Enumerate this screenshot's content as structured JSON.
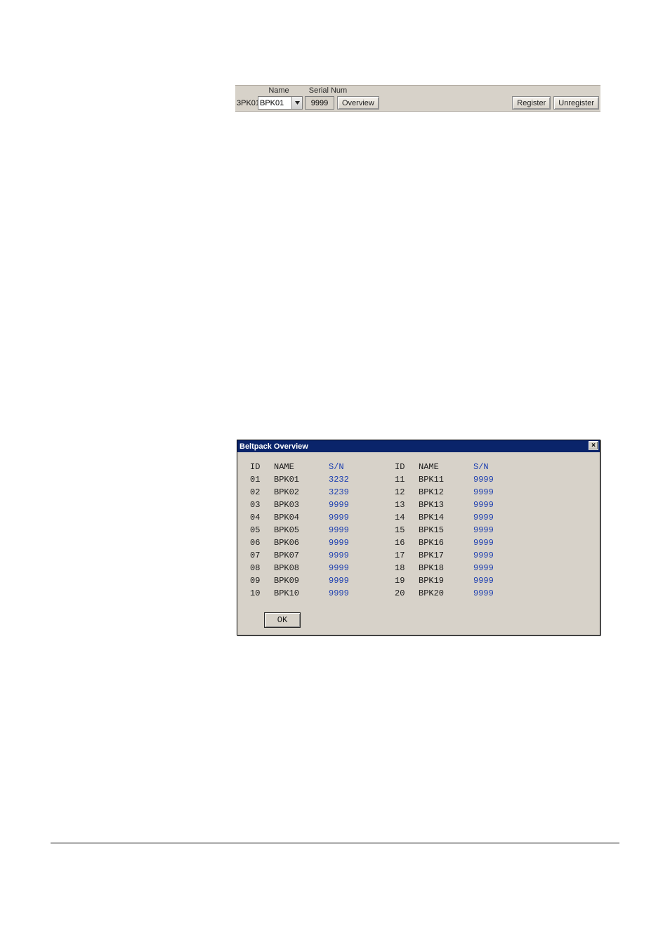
{
  "toolbar": {
    "name_header": "Name",
    "sn_header": "Serial Num",
    "id_value": "3PK01",
    "name_value": "BPK01",
    "sn_value": "9999",
    "overview_label": "Overview",
    "register_label": "Register",
    "unregister_label": "Unregister"
  },
  "dialog": {
    "title": "Beltpack Overview",
    "close_glyph": "×",
    "header_id": "ID",
    "header_name": "NAME",
    "header_sn": "S/N",
    "ok_label": "OK",
    "left_rows": [
      {
        "id": "01",
        "name": "BPK01",
        "sn": "3232"
      },
      {
        "id": "02",
        "name": "BPK02",
        "sn": "3239"
      },
      {
        "id": "03",
        "name": "BPK03",
        "sn": "9999"
      },
      {
        "id": "04",
        "name": "BPK04",
        "sn": "9999"
      },
      {
        "id": "05",
        "name": "BPK05",
        "sn": "9999"
      },
      {
        "id": "06",
        "name": "BPK06",
        "sn": "9999"
      },
      {
        "id": "07",
        "name": "BPK07",
        "sn": "9999"
      },
      {
        "id": "08",
        "name": "BPK08",
        "sn": "9999"
      },
      {
        "id": "09",
        "name": "BPK09",
        "sn": "9999"
      },
      {
        "id": "10",
        "name": "BPK10",
        "sn": "9999"
      }
    ],
    "right_rows": [
      {
        "id": "11",
        "name": "BPK11",
        "sn": "9999"
      },
      {
        "id": "12",
        "name": "BPK12",
        "sn": "9999"
      },
      {
        "id": "13",
        "name": "BPK13",
        "sn": "9999"
      },
      {
        "id": "14",
        "name": "BPK14",
        "sn": "9999"
      },
      {
        "id": "15",
        "name": "BPK15",
        "sn": "9999"
      },
      {
        "id": "16",
        "name": "BPK16",
        "sn": "9999"
      },
      {
        "id": "17",
        "name": "BPK17",
        "sn": "9999"
      },
      {
        "id": "18",
        "name": "BPK18",
        "sn": "9999"
      },
      {
        "id": "19",
        "name": "BPK19",
        "sn": "9999"
      },
      {
        "id": "20",
        "name": "BPK20",
        "sn": "9999"
      }
    ]
  }
}
